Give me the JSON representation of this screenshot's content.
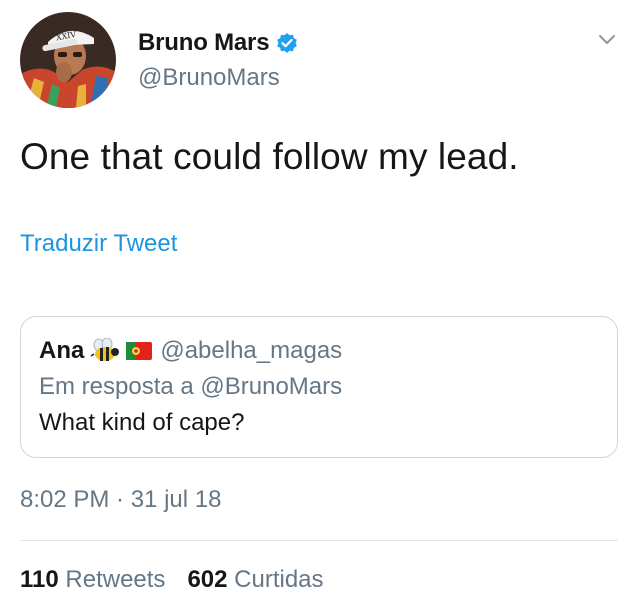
{
  "author": {
    "display_name": "Bruno Mars",
    "handle": "@BrunoMars",
    "verified": true,
    "avatar_icon": "profile-photo",
    "avatar_cap_text": "XXIV"
  },
  "menu_icon": "chevron-down-icon",
  "tweet": {
    "text": "One that could follow my lead.",
    "translate_label": "Traduzir Tweet"
  },
  "quoted_tweet": {
    "display_name": "Ana",
    "name_emojis": [
      "bee-emoji",
      "portugal-flag-emoji"
    ],
    "handle": "@abelha_magas",
    "reply_context": "Em resposta a @BrunoMars",
    "text": "What kind of cape?"
  },
  "timestamp": "8:02 PM · 31 jul 18",
  "stats": {
    "retweets_count": "110",
    "retweets_label": "Retweets",
    "likes_count": "602",
    "likes_label": "Curtidas"
  },
  "colors": {
    "link": "#1b95e0",
    "secondary_text": "#657786",
    "primary_text": "#14171a",
    "border": "#ccd6dd",
    "verified_badge": "#1da1f2"
  }
}
